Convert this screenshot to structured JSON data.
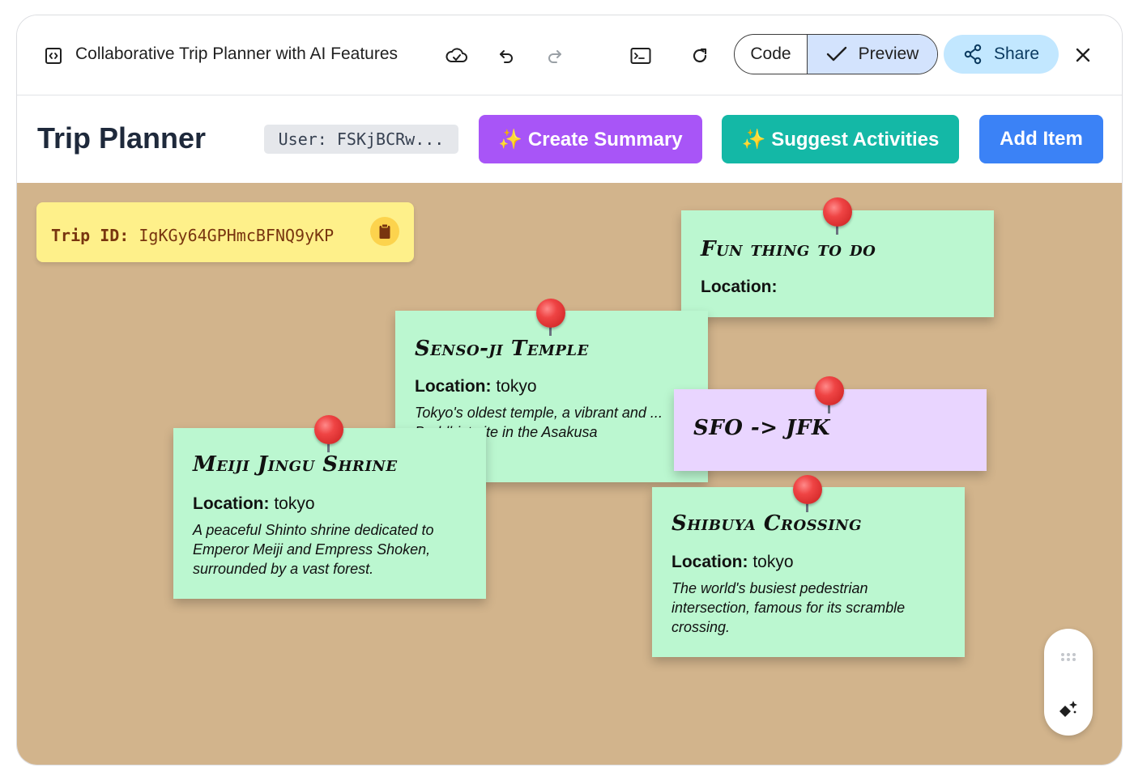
{
  "window": {
    "title": "Collaborative Trip Planner with AI Features",
    "code_label": "Code",
    "preview_label": "Preview",
    "share_label": "Share"
  },
  "app": {
    "title": "Trip Planner",
    "user_label": "User: FSKjBCRw...",
    "create_summary_label": "✨ Create Summary",
    "suggest_activities_label": "✨ Suggest Activities",
    "add_item_label": "Add Item"
  },
  "trip": {
    "id_label": "Trip ID:",
    "id_value": "IgKGy64GPHmcBFNQ9yKP"
  },
  "notes": [
    {
      "title": "Fun thing to do",
      "location_label": "Location:",
      "location": "",
      "description": "",
      "color": "#bbf7d0"
    },
    {
      "title": "Senso-ji Temple",
      "location_label": "Location:",
      "location": "tokyo",
      "description": "Tokyo's oldest temple, a vibrant and ... Buddhist site in the Asakusa",
      "color": "#bbf7d0"
    },
    {
      "title": "SFO -> JFK",
      "location_label": "",
      "location": "",
      "description": "",
      "color": "#e9d5ff"
    },
    {
      "title": "Meiji Jingu Shrine",
      "location_label": "Location:",
      "location": "tokyo",
      "description": "A peaceful Shinto shrine dedicated to Emperor Meiji and Empress Shoken, surrounded by a vast forest.",
      "color": "#bbf7d0"
    },
    {
      "title": "Shibuya Crossing",
      "location_label": "Location:",
      "location": "tokyo",
      "description": "The world's busiest pedestrian intersection, famous for its scramble crossing.",
      "color": "#bbf7d0"
    }
  ],
  "icons": {
    "code_embed": "code-embed-icon",
    "cloud_sync": "cloud-sync-icon",
    "undo": "undo-icon",
    "redo": "redo-icon",
    "terminal": "terminal-icon",
    "refresh": "refresh-icon",
    "check": "check-icon",
    "share": "share-icon",
    "close": "close-icon",
    "clipboard": "clipboard-icon",
    "drag": "drag-handle-icon",
    "sparkle": "sparkle-icon"
  },
  "colors": {
    "board": "#d2b48c",
    "purple_button": "#a855f7",
    "teal_button": "#14b8a6",
    "blue_button": "#3b82f6",
    "trip_id_card": "#fef08a",
    "pin": "#ef4444"
  }
}
